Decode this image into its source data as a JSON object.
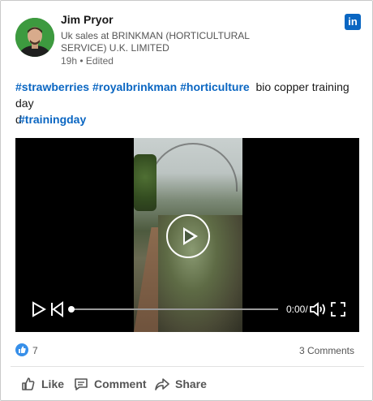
{
  "author": {
    "name": "Jim Pryor",
    "headline": "Uk sales at BRINKMAN (HORTICULTURAL SERVICE) U.K. LIMITED",
    "timestamp": "19h • Edited"
  },
  "network_logo": "in",
  "post": {
    "hashtags_line1": [
      "#strawberries",
      "#royalbrinkman",
      "#horticulture"
    ],
    "text": "bio copper training day",
    "text_wrap": "d",
    "hashtag_line2": "#trainingday"
  },
  "video": {
    "time": "0:00/",
    "progress": 0
  },
  "social": {
    "likes": "7",
    "comments": "3 Comments"
  },
  "actions": {
    "like": "Like",
    "comment": "Comment",
    "share": "Share"
  },
  "colors": {
    "accent": "#0a66c2",
    "text": "#191919",
    "muted": "#555555"
  },
  "icons": [
    "linkedin-icon",
    "play-icon",
    "skip-back-icon",
    "volume-icon",
    "fullscreen-icon",
    "like-icon",
    "comment-icon",
    "share-icon"
  ]
}
